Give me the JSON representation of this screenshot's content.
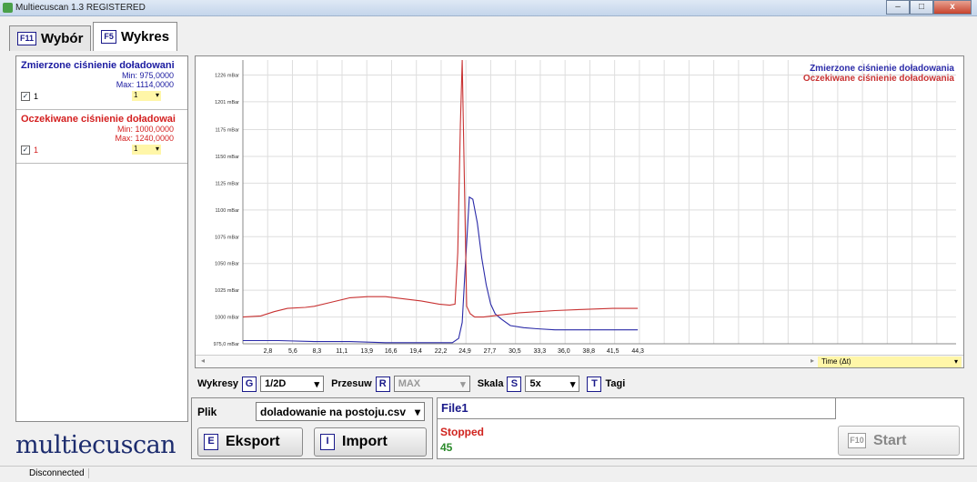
{
  "window": {
    "title": "Multiecuscan 1.3 REGISTERED",
    "minimize": "–",
    "maximize": "□",
    "close": "x"
  },
  "tabs": [
    {
      "key": "F11",
      "label": "Wybór"
    },
    {
      "key": "F5",
      "label": "Wykres"
    }
  ],
  "series_panel": [
    {
      "name": "Zmierzone ciśnienie doładowani",
      "min": "Min: 975,0000",
      "max": "Max: 1114,0000",
      "index": "1",
      "color": "#1a1aa0",
      "checked": true
    },
    {
      "name": "Oczekiwane ciśnienie doładowai",
      "min": "Min: 1000,0000",
      "max": "Max: 1240,0000",
      "index": "1",
      "color": "#d42020",
      "checked": true
    }
  ],
  "logo": "multiecuscan",
  "chart_data": {
    "type": "line",
    "legend": [
      "Zmierzone ciśnienie doładowania",
      "Oczekiwane ciśnienie doładowania"
    ],
    "legend_position": "top-right",
    "xlabel": "Time (Δt)",
    "x_ticks": [
      "2,8",
      "5,6",
      "8,3",
      "11,1",
      "13,9",
      "16,6",
      "19,4",
      "22,2",
      "24,9",
      "27,7",
      "30,5",
      "33,3",
      "36,0",
      "38,8",
      "41,5",
      "44,3"
    ],
    "x_tick_values": [
      2.8,
      5.6,
      8.3,
      11.1,
      13.9,
      16.6,
      19.4,
      22.2,
      24.9,
      27.7,
      30.5,
      33.3,
      36.0,
      38.8,
      41.5,
      44.3
    ],
    "y_ticks": [
      "975,0 mBar",
      "1000 mBar",
      "1025 mBar",
      "1050 mBar",
      "1075 mBar",
      "1100 mBar",
      "1125 mBar",
      "1150 mBar",
      "1175 mBar",
      "1201 mBar",
      "1226 mBar"
    ],
    "y_tick_values": [
      975,
      1000,
      1025,
      1050,
      1075,
      1100,
      1125,
      1150,
      1175,
      1201,
      1226
    ],
    "xlim": [
      0,
      80
    ],
    "ylim": [
      975,
      1240
    ],
    "grid": true,
    "series": [
      {
        "name": "Zmierzone ciśnienie doładowania",
        "color": "#2a2aa8",
        "x": [
          0,
          4,
          8,
          12,
          16,
          20,
          23.5,
          24.2,
          24.6,
          24.9,
          25.4,
          25.8,
          26.3,
          26.8,
          27.3,
          27.8,
          28.3,
          29,
          30,
          31.5,
          33,
          35,
          38,
          41.5,
          44.3
        ],
        "y": [
          978,
          978,
          977,
          977,
          976,
          976,
          976,
          980,
          995,
          1040,
          1112,
          1110,
          1088,
          1055,
          1030,
          1012,
          1003,
          998,
          992,
          990,
          989,
          988,
          988,
          988,
          988
        ]
      },
      {
        "name": "Oczekiwane ciśnienie doładowania",
        "color": "#c83232",
        "x": [
          0,
          2,
          3.5,
          5,
          7,
          8,
          10,
          12,
          14,
          16,
          18,
          20,
          22,
          23.2,
          23.8,
          24.1,
          24.4,
          24.6,
          24.8,
          25.1,
          25.5,
          26,
          27,
          29,
          31,
          33,
          35,
          38,
          41.5,
          44.3
        ],
        "y": [
          1000,
          1001,
          1005,
          1008,
          1009,
          1010,
          1014,
          1018,
          1019,
          1019,
          1017,
          1015,
          1012,
          1011,
          1012,
          1060,
          1180,
          1240,
          1150,
          1010,
          1003,
          1000,
          1000,
          1002,
          1004,
          1005,
          1006,
          1007,
          1008,
          1008
        ]
      }
    ]
  },
  "controls": {
    "wykresy_label": "Wykresy",
    "wykresy_key": "G",
    "wykresy_value": "1/2D",
    "przesuw_label": "Przesuw",
    "przesuw_key": "R",
    "przesuw_value": "MAX",
    "skala_label": "Skala",
    "skala_key": "S",
    "skala_value": "5x",
    "tagi_key": "T",
    "tagi_label": "Tagi"
  },
  "file_panel": {
    "label": "Plik",
    "file": "doladowanie na postoju.csv",
    "export_key": "E",
    "export_label": "Eksport",
    "import_key": "I",
    "import_label": "Import"
  },
  "status_panel": {
    "file_name": "File1",
    "state": "Stopped",
    "count": "45",
    "start_key": "F10",
    "start_label": "Start"
  },
  "statusbar": {
    "connection": "Disconnected"
  }
}
